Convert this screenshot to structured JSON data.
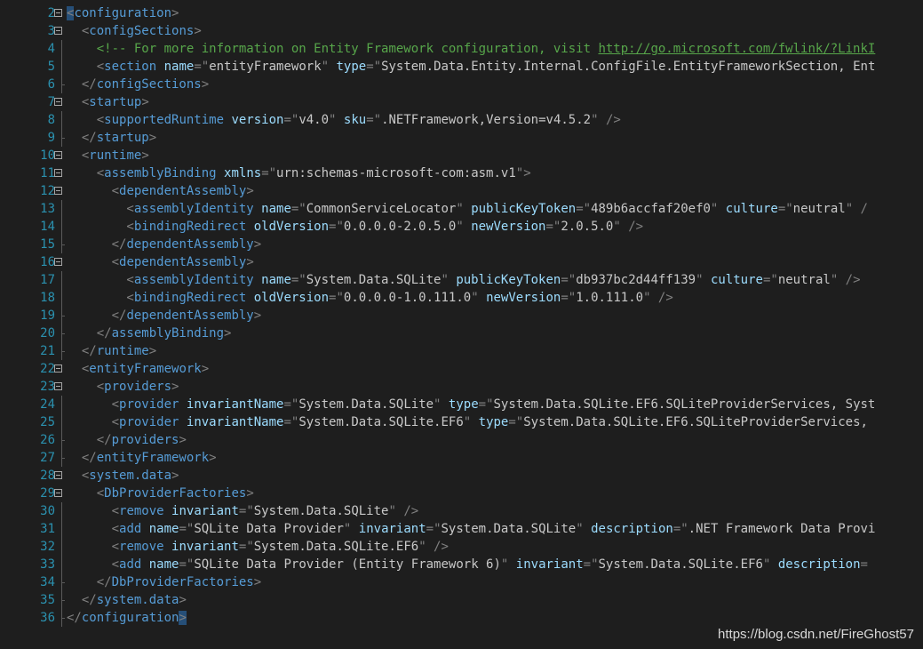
{
  "editor": {
    "lines": [
      {
        "n": "2",
        "fold": true,
        "segs": [
          [
            "hl",
            "<"
          ],
          [
            "t",
            "configuration"
          ],
          [
            "sym",
            ">"
          ]
        ]
      },
      {
        "n": "3",
        "fold": true,
        "segs": [
          [
            "sym",
            "  <"
          ],
          [
            "t",
            "configSections"
          ],
          [
            "sym",
            ">"
          ]
        ]
      },
      {
        "n": "4",
        "fold": false,
        "segs": [
          [
            "sym",
            "    "
          ],
          [
            "cm",
            "<!-- For more information on Entity Framework configuration, visit "
          ],
          [
            "lk",
            "http://go.microsoft.com/fwlink/?LinkI"
          ]
        ]
      },
      {
        "n": "5",
        "fold": false,
        "segs": [
          [
            "sym",
            "    <"
          ],
          [
            "t",
            "section"
          ],
          [
            "av",
            " "
          ],
          [
            "an",
            "name"
          ],
          [
            "sym",
            "=\""
          ],
          [
            "av",
            "entityFramework"
          ],
          [
            "sym",
            "\""
          ],
          [
            "av",
            " "
          ],
          [
            "an",
            "type"
          ],
          [
            "sym",
            "=\""
          ],
          [
            "av",
            "System.Data.Entity.Internal.ConfigFile.EntityFrameworkSection, Ent"
          ]
        ]
      },
      {
        "n": "6",
        "fold": false,
        "segs": [
          [
            "sym",
            "  </"
          ],
          [
            "t",
            "configSections"
          ],
          [
            "sym",
            ">"
          ]
        ]
      },
      {
        "n": "7",
        "fold": true,
        "segs": [
          [
            "sym",
            "  <"
          ],
          [
            "t",
            "startup"
          ],
          [
            "sym",
            ">"
          ]
        ]
      },
      {
        "n": "8",
        "fold": false,
        "segs": [
          [
            "sym",
            "    <"
          ],
          [
            "t",
            "supportedRuntime"
          ],
          [
            "av",
            " "
          ],
          [
            "an",
            "version"
          ],
          [
            "sym",
            "=\""
          ],
          [
            "av",
            "v4.0"
          ],
          [
            "sym",
            "\""
          ],
          [
            "av",
            " "
          ],
          [
            "an",
            "sku"
          ],
          [
            "sym",
            "=\""
          ],
          [
            "av",
            ".NETFramework,Version=v4.5.2"
          ],
          [
            "sym",
            "\" />"
          ]
        ]
      },
      {
        "n": "9",
        "fold": false,
        "segs": [
          [
            "sym",
            "  </"
          ],
          [
            "t",
            "startup"
          ],
          [
            "sym",
            ">"
          ]
        ]
      },
      {
        "n": "10",
        "fold": true,
        "segs": [
          [
            "sym",
            "  <"
          ],
          [
            "t",
            "runtime"
          ],
          [
            "sym",
            ">"
          ]
        ]
      },
      {
        "n": "11",
        "fold": true,
        "segs": [
          [
            "sym",
            "    <"
          ],
          [
            "t",
            "assemblyBinding"
          ],
          [
            "av",
            " "
          ],
          [
            "an",
            "xmlns"
          ],
          [
            "sym",
            "=\""
          ],
          [
            "av",
            "urn:schemas-microsoft-com:asm.v1"
          ],
          [
            "sym",
            "\">"
          ]
        ]
      },
      {
        "n": "12",
        "fold": true,
        "segs": [
          [
            "sym",
            "      <"
          ],
          [
            "t",
            "dependentAssembly"
          ],
          [
            "sym",
            ">"
          ]
        ]
      },
      {
        "n": "13",
        "fold": false,
        "segs": [
          [
            "sym",
            "        <"
          ],
          [
            "t",
            "assemblyIdentity"
          ],
          [
            "av",
            " "
          ],
          [
            "an",
            "name"
          ],
          [
            "sym",
            "=\""
          ],
          [
            "av",
            "CommonServiceLocator"
          ],
          [
            "sym",
            "\""
          ],
          [
            "av",
            " "
          ],
          [
            "an",
            "publicKeyToken"
          ],
          [
            "sym",
            "=\""
          ],
          [
            "av",
            "489b6accfaf20ef0"
          ],
          [
            "sym",
            "\""
          ],
          [
            "av",
            " "
          ],
          [
            "an",
            "culture"
          ],
          [
            "sym",
            "=\""
          ],
          [
            "av",
            "neutral"
          ],
          [
            "sym",
            "\" /"
          ]
        ]
      },
      {
        "n": "14",
        "fold": false,
        "segs": [
          [
            "sym",
            "        <"
          ],
          [
            "t",
            "bindingRedirect"
          ],
          [
            "av",
            " "
          ],
          [
            "an",
            "oldVersion"
          ],
          [
            "sym",
            "=\""
          ],
          [
            "av",
            "0.0.0.0-2.0.5.0"
          ],
          [
            "sym",
            "\""
          ],
          [
            "av",
            " "
          ],
          [
            "an",
            "newVersion"
          ],
          [
            "sym",
            "=\""
          ],
          [
            "av",
            "2.0.5.0"
          ],
          [
            "sym",
            "\" />"
          ]
        ]
      },
      {
        "n": "15",
        "fold": false,
        "segs": [
          [
            "sym",
            "      </"
          ],
          [
            "t",
            "dependentAssembly"
          ],
          [
            "sym",
            ">"
          ]
        ]
      },
      {
        "n": "16",
        "fold": true,
        "segs": [
          [
            "sym",
            "      <"
          ],
          [
            "t",
            "dependentAssembly"
          ],
          [
            "sym",
            ">"
          ]
        ]
      },
      {
        "n": "17",
        "fold": false,
        "segs": [
          [
            "sym",
            "        <"
          ],
          [
            "t",
            "assemblyIdentity"
          ],
          [
            "av",
            " "
          ],
          [
            "an",
            "name"
          ],
          [
            "sym",
            "=\""
          ],
          [
            "av",
            "System.Data.SQLite"
          ],
          [
            "sym",
            "\""
          ],
          [
            "av",
            " "
          ],
          [
            "an",
            "publicKeyToken"
          ],
          [
            "sym",
            "=\""
          ],
          [
            "av",
            "db937bc2d44ff139"
          ],
          [
            "sym",
            "\""
          ],
          [
            "av",
            " "
          ],
          [
            "an",
            "culture"
          ],
          [
            "sym",
            "=\""
          ],
          [
            "av",
            "neutral"
          ],
          [
            "sym",
            "\" />"
          ]
        ]
      },
      {
        "n": "18",
        "fold": false,
        "segs": [
          [
            "sym",
            "        <"
          ],
          [
            "t",
            "bindingRedirect"
          ],
          [
            "av",
            " "
          ],
          [
            "an",
            "oldVersion"
          ],
          [
            "sym",
            "=\""
          ],
          [
            "av",
            "0.0.0.0-1.0.111.0"
          ],
          [
            "sym",
            "\""
          ],
          [
            "av",
            " "
          ],
          [
            "an",
            "newVersion"
          ],
          [
            "sym",
            "=\""
          ],
          [
            "av",
            "1.0.111.0"
          ],
          [
            "sym",
            "\" />"
          ]
        ]
      },
      {
        "n": "19",
        "fold": false,
        "segs": [
          [
            "sym",
            "      </"
          ],
          [
            "t",
            "dependentAssembly"
          ],
          [
            "sym",
            ">"
          ]
        ]
      },
      {
        "n": "20",
        "fold": false,
        "segs": [
          [
            "sym",
            "    </"
          ],
          [
            "t",
            "assemblyBinding"
          ],
          [
            "sym",
            ">"
          ]
        ]
      },
      {
        "n": "21",
        "fold": false,
        "segs": [
          [
            "sym",
            "  </"
          ],
          [
            "t",
            "runtime"
          ],
          [
            "sym",
            ">"
          ]
        ]
      },
      {
        "n": "22",
        "fold": true,
        "segs": [
          [
            "sym",
            "  <"
          ],
          [
            "t",
            "entityFramework"
          ],
          [
            "sym",
            ">"
          ]
        ]
      },
      {
        "n": "23",
        "fold": true,
        "segs": [
          [
            "sym",
            "    <"
          ],
          [
            "t",
            "providers"
          ],
          [
            "sym",
            ">"
          ]
        ]
      },
      {
        "n": "24",
        "fold": false,
        "segs": [
          [
            "sym",
            "      <"
          ],
          [
            "t",
            "provider"
          ],
          [
            "av",
            " "
          ],
          [
            "an",
            "invariantName"
          ],
          [
            "sym",
            "=\""
          ],
          [
            "av",
            "System.Data.SQLite"
          ],
          [
            "sym",
            "\""
          ],
          [
            "av",
            " "
          ],
          [
            "an",
            "type"
          ],
          [
            "sym",
            "=\""
          ],
          [
            "av",
            "System.Data.SQLite.EF6.SQLiteProviderServices, Syst"
          ]
        ]
      },
      {
        "n": "25",
        "fold": false,
        "segs": [
          [
            "sym",
            "      <"
          ],
          [
            "t",
            "provider"
          ],
          [
            "av",
            " "
          ],
          [
            "an",
            "invariantName"
          ],
          [
            "sym",
            "=\""
          ],
          [
            "av",
            "System.Data.SQLite.EF6"
          ],
          [
            "sym",
            "\""
          ],
          [
            "av",
            " "
          ],
          [
            "an",
            "type"
          ],
          [
            "sym",
            "=\""
          ],
          [
            "av",
            "System.Data.SQLite.EF6.SQLiteProviderServices,"
          ]
        ]
      },
      {
        "n": "26",
        "fold": false,
        "segs": [
          [
            "sym",
            "    </"
          ],
          [
            "t",
            "providers"
          ],
          [
            "sym",
            ">"
          ]
        ]
      },
      {
        "n": "27",
        "fold": false,
        "segs": [
          [
            "sym",
            "  </"
          ],
          [
            "t",
            "entityFramework"
          ],
          [
            "sym",
            ">"
          ]
        ]
      },
      {
        "n": "28",
        "fold": true,
        "segs": [
          [
            "sym",
            "  <"
          ],
          [
            "t",
            "system.data"
          ],
          [
            "sym",
            ">"
          ]
        ]
      },
      {
        "n": "29",
        "fold": true,
        "segs": [
          [
            "sym",
            "    <"
          ],
          [
            "t",
            "DbProviderFactories"
          ],
          [
            "sym",
            ">"
          ]
        ]
      },
      {
        "n": "30",
        "fold": false,
        "segs": [
          [
            "sym",
            "      <"
          ],
          [
            "t",
            "remove"
          ],
          [
            "av",
            " "
          ],
          [
            "an",
            "invariant"
          ],
          [
            "sym",
            "=\""
          ],
          [
            "av",
            "System.Data.SQLite"
          ],
          [
            "sym",
            "\" />"
          ]
        ]
      },
      {
        "n": "31",
        "fold": false,
        "segs": [
          [
            "sym",
            "      <"
          ],
          [
            "t",
            "add"
          ],
          [
            "av",
            " "
          ],
          [
            "an",
            "name"
          ],
          [
            "sym",
            "=\""
          ],
          [
            "av",
            "SQLite Data Provider"
          ],
          [
            "sym",
            "\""
          ],
          [
            "av",
            " "
          ],
          [
            "an",
            "invariant"
          ],
          [
            "sym",
            "=\""
          ],
          [
            "av",
            "System.Data.SQLite"
          ],
          [
            "sym",
            "\""
          ],
          [
            "av",
            " "
          ],
          [
            "an",
            "description"
          ],
          [
            "sym",
            "=\""
          ],
          [
            "av",
            ".NET Framework Data Provi"
          ]
        ]
      },
      {
        "n": "32",
        "fold": false,
        "segs": [
          [
            "sym",
            "      <"
          ],
          [
            "t",
            "remove"
          ],
          [
            "av",
            " "
          ],
          [
            "an",
            "invariant"
          ],
          [
            "sym",
            "=\""
          ],
          [
            "av",
            "System.Data.SQLite.EF6"
          ],
          [
            "sym",
            "\" />"
          ]
        ]
      },
      {
        "n": "33",
        "fold": false,
        "segs": [
          [
            "sym",
            "      <"
          ],
          [
            "t",
            "add"
          ],
          [
            "av",
            " "
          ],
          [
            "an",
            "name"
          ],
          [
            "sym",
            "=\""
          ],
          [
            "av",
            "SQLite Data Provider (Entity Framework 6)"
          ],
          [
            "sym",
            "\""
          ],
          [
            "av",
            " "
          ],
          [
            "an",
            "invariant"
          ],
          [
            "sym",
            "=\""
          ],
          [
            "av",
            "System.Data.SQLite.EF6"
          ],
          [
            "sym",
            "\""
          ],
          [
            "av",
            " "
          ],
          [
            "an",
            "description"
          ],
          [
            "sym",
            "="
          ]
        ]
      },
      {
        "n": "34",
        "fold": false,
        "segs": [
          [
            "sym",
            "    </"
          ],
          [
            "t",
            "DbProviderFactories"
          ],
          [
            "sym",
            ">"
          ]
        ]
      },
      {
        "n": "35",
        "fold": false,
        "segs": [
          [
            "sym",
            "  </"
          ],
          [
            "t",
            "system.data"
          ],
          [
            "sym",
            ">"
          ]
        ]
      },
      {
        "n": "36",
        "fold": false,
        "segs": [
          [
            "sym",
            "</"
          ],
          [
            "t",
            "configuration"
          ],
          [
            "hl",
            ">"
          ]
        ]
      }
    ]
  },
  "watermark": "https://blog.csdn.net/FireGhost57",
  "colors": {
    "background": "#1e1e1e",
    "line_number": "#2b91af",
    "tag": "#569cd6",
    "attribute_name": "#9cdcfe",
    "attribute_value": "#c8c8c8",
    "comment": "#57a64a",
    "brace_highlight": "#264f78"
  }
}
